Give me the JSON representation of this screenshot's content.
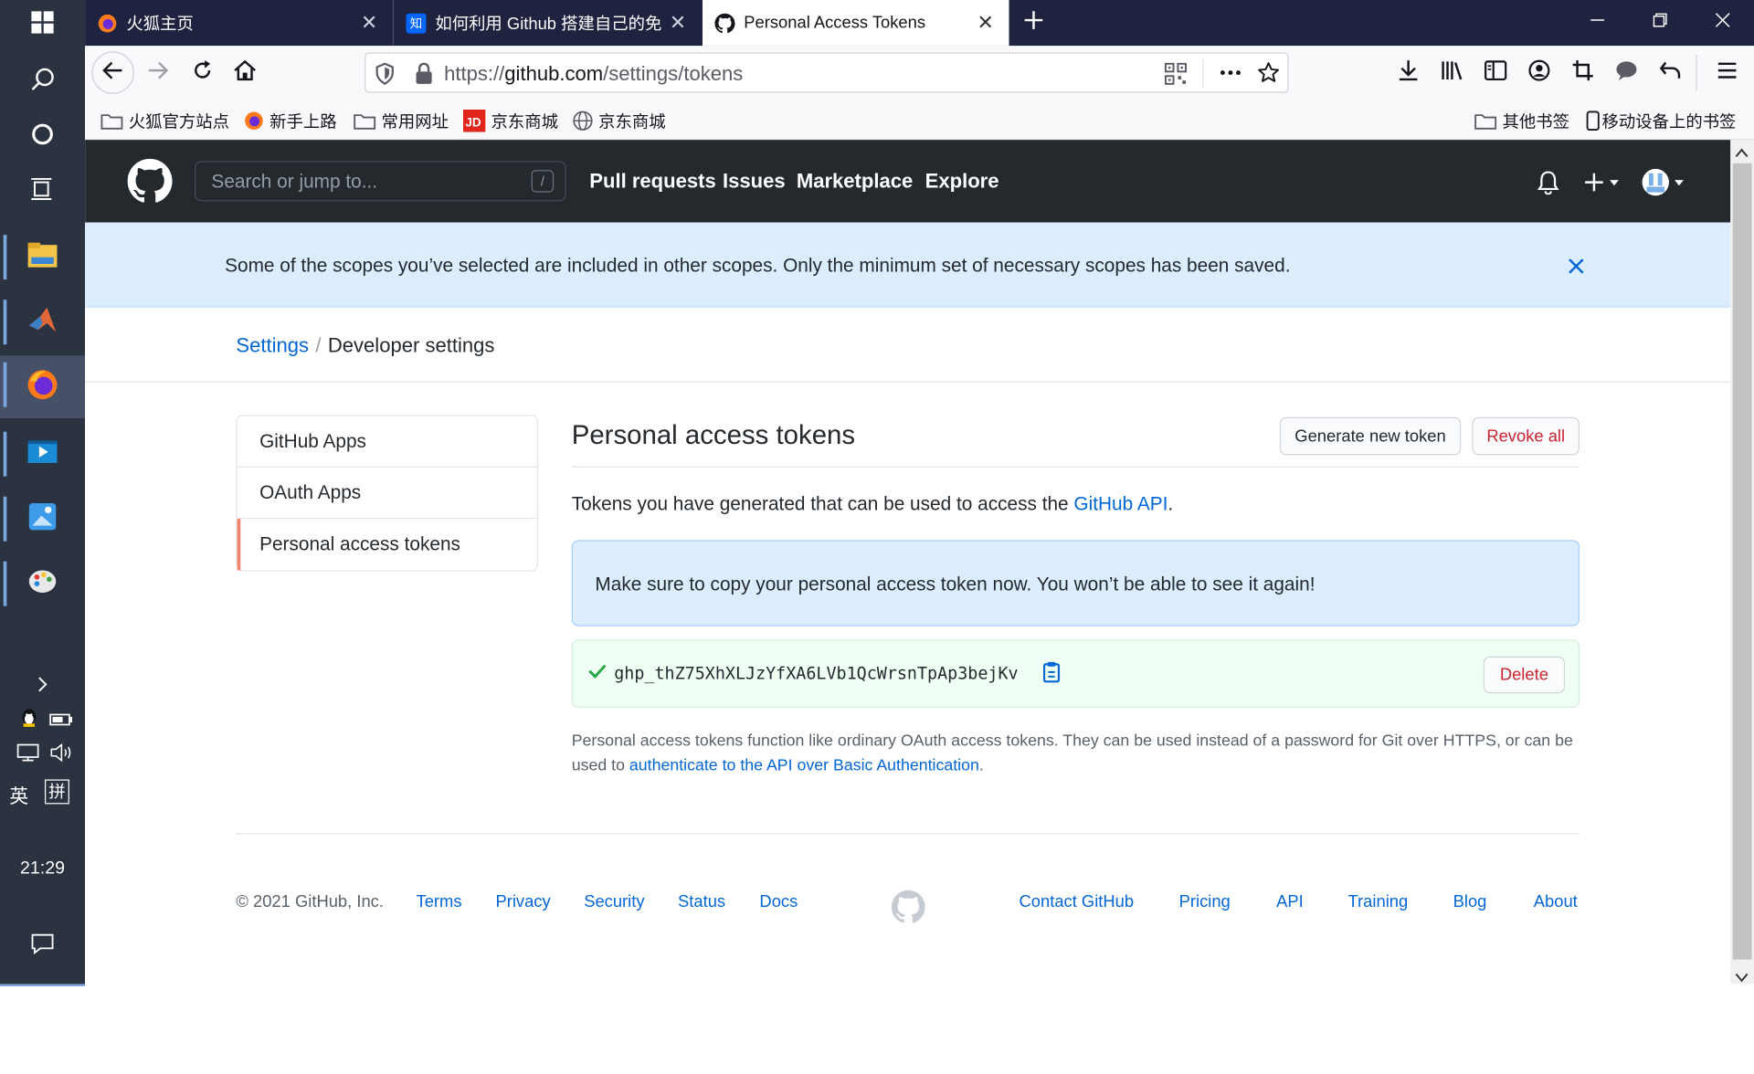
{
  "taskbar": {
    "clock": "21:29",
    "ime_lang": "英",
    "ime_mode": "拼"
  },
  "browser": {
    "tabs": [
      {
        "title": "火狐主页"
      },
      {
        "title": "如何利用 Github 搭建自己的免"
      },
      {
        "title": "Personal Access Tokens"
      }
    ],
    "url_prefix": "https://",
    "url_domain": "github.com",
    "url_path": "/settings/tokens",
    "bookmarks": {
      "items": [
        {
          "label": "火狐官方站点"
        },
        {
          "label": "新手上路"
        },
        {
          "label": "常用网址"
        },
        {
          "label": "京东商城"
        },
        {
          "label": "京东商城"
        }
      ],
      "other": "其他书签",
      "mobile": "移动设备上的书签"
    }
  },
  "github": {
    "search_placeholder": "Search or jump to...",
    "search_shortcut": "/",
    "nav": [
      "Pull requests",
      "Issues",
      "Marketplace",
      "Explore"
    ],
    "flash_message": "Some of the scopes you’ve selected are included in other scopes. Only the minimum set of necessary scopes has been saved.",
    "breadcrumb": {
      "root": "Settings",
      "separator": "/",
      "current": "Developer settings"
    },
    "menu": [
      "GitHub Apps",
      "OAuth Apps",
      "Personal access tokens"
    ],
    "title": "Personal access tokens",
    "generate_button": "Generate new token",
    "revoke_button": "Revoke all",
    "intro_text": "Tokens you have generated that can be used to access the ",
    "intro_link": "GitHub API",
    "intro_end": ".",
    "notice": "Make sure to copy your personal access token now. You won’t be able to see it again!",
    "token": "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",
    "delete_button": "Delete",
    "note_text": "Personal access tokens function like ordinary OAuth access tokens. They can be used instead of a password for Git over HTTPS, or can be used to ",
    "note_link": "authenticate to the API over Basic Authentication",
    "note_end": ".",
    "footer": {
      "copyright": "© 2021 GitHub, Inc.",
      "left_links": [
        "Terms",
        "Privacy",
        "Security",
        "Status",
        "Docs"
      ],
      "right_links": [
        "Contact GitHub",
        "Pricing",
        "API",
        "Training",
        "Blog",
        "About"
      ]
    }
  },
  "colors": {
    "header": "#24292e",
    "link": "#0366d6",
    "flash": "#dbedff",
    "success": "#28a745",
    "danger": "#cb2431",
    "taskbar": "#2b3240",
    "tabstrip": "#1f2340"
  }
}
